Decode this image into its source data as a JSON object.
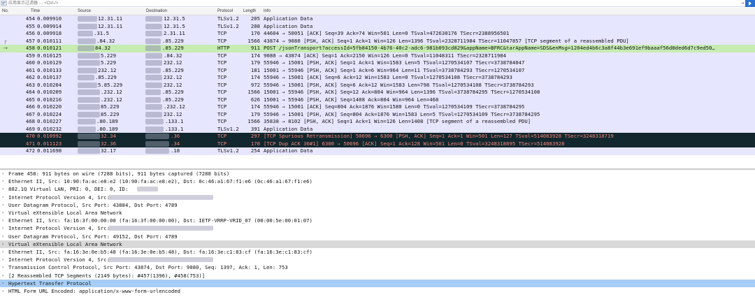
{
  "filter": {
    "placeholder": "应用显示过滤器 … <Ctrl-/>",
    "arrow": "→",
    "apply_icon": "apply-filter-icon",
    "bookmark_icon": "bookmark-filter-icon"
  },
  "columns": {
    "no": "No.",
    "time": "Time",
    "source": "Source",
    "destination": "Destination",
    "protocol": "Protocol",
    "length": "Length",
    "info": "Info"
  },
  "packets": [
    {
      "no": "454",
      "time": "0.009910",
      "src": "12.31.11",
      "dst": "12.31.5",
      "proto": "TLSv1.2",
      "len": "205",
      "info": "Application Data",
      "bg": "#e7e6ff",
      "fg": "#111111"
    },
    {
      "no": "455",
      "time": "0.009914",
      "src": "12.31.11",
      "dst": "12.31.5",
      "proto": "TLSv1.2",
      "len": "208",
      "info": "Application Data",
      "bg": "#e7e6ff",
      "fg": "#111111"
    },
    {
      "no": "456",
      "time": "0.009918",
      "src": ".31.5",
      "dst": "2.31.11",
      "proto": "TCP",
      "len": "170",
      "info": "44604 → 50051 [ACK] Seq=39 Ack=74 Win=501 Len=0 TSval=472630176 TSecr=2388956501",
      "bg": "#e7e6ff",
      "fg": "#111111"
    },
    {
      "no": "457",
      "time": "0.010111",
      "src": ".84.32",
      "dst": ".85.229",
      "proto": "TCP",
      "len": "1566",
      "info": "43874 → 9080 [PSH, ACK] Seq=1 Ack=1 Win=126 Len=1396 TSval=2328711984 TSecr=11047857 [TCP segment of a reassembled PDU]",
      "bg": "#e7e6ff",
      "fg": "#111111"
    },
    {
      "no": "458",
      "time": "0.010121",
      "src": "84.32",
      "dst": ".85.229",
      "proto": "HTTP",
      "len": "911",
      "info": "POST /jsonTransport?accessId=5fb84150-4b76-40c2-adc6-981b093cd829&appName=BFRC&tarAppName=SDS&enMsg=1204ed4b6c3a8f44b3e691ef9baaaf56d8ded6d7c9ed50…",
      "bg": "#c6ecb2",
      "fg": "#111111"
    },
    {
      "no": "459",
      "time": "0.010125",
      "src": "5.229",
      "dst": ".84.32",
      "proto": "TCP",
      "len": "174",
      "info": "9080 → 43874 [ACK] Seq=1 Ack=2150 Win=126 Len=0 TSval=11048311 TSecr=2328711984",
      "bg": "#e7e6ff",
      "fg": "#111111"
    },
    {
      "no": "460",
      "time": "0.010129",
      "src": "5.229",
      "dst": "232.12",
      "proto": "TCP",
      "len": "179",
      "info": "55946 → 15001 [PSH, ACK] Seq=1 Ack=1 Win=1583 Len=5 TSval=1270534107 TSecr=3738784047",
      "bg": "#e7e6ff",
      "fg": "#111111"
    },
    {
      "no": "461",
      "time": "0.010133",
      "src": "232.12",
      "dst": ".85.229",
      "proto": "TCP",
      "len": "181",
      "info": "15001 → 55946 [PSH, ACK] Seq=1 Ack=6 Win=964 Len=11 TSval=3738784293 TSecr=1270534107",
      "bg": "#e7e6ff",
      "fg": "#111111"
    },
    {
      "no": "462",
      "time": "0.010137",
      "src": ".85.229",
      "dst": "232.12",
      "proto": "TCP",
      "len": "174",
      "info": "55946 → 15001 [ACK] Seq=6 Ack=12 Win=1583 Len=0 TSval=1270534108 TSecr=3738784293",
      "bg": "#e7e6ff",
      "fg": "#111111"
    },
    {
      "no": "463",
      "time": "0.010204",
      "src": "5.85.229",
      "dst": "232.12",
      "proto": "TCP",
      "len": "972",
      "info": "55946 → 15001 [PSH, ACK] Seq=6 Ack=12 Win=1583 Len=798 TSval=1270534108 TSecr=3738784293",
      "bg": "#e7e6ff",
      "fg": "#111111"
    },
    {
      "no": "464",
      "time": "0.010209",
      "src": ".232.12",
      "dst": ".85.229",
      "proto": "TCP",
      "len": "1566",
      "info": "15001 → 55946 [PSH, ACK] Seq=12 Ack=804 Win=964 Len=1396 TSval=3738784295 TSecr=1270534108",
      "bg": "#e7e6ff",
      "fg": "#111111"
    },
    {
      "no": "465",
      "time": "0.010216",
      "src": ".232.12",
      "dst": ".85.229",
      "proto": "TCP",
      "len": "626",
      "info": "15001 → 55946 [PSH, ACK] Seq=1408 Ack=804 Win=964 Len=468",
      "bg": "#e7e6ff",
      "fg": "#111111"
    },
    {
      "no": "466",
      "time": "0.010220",
      "src": "85.229",
      "dst": ".232.12",
      "proto": "TCP",
      "len": "174",
      "info": "55946 → 15001 [ACK] Seq=804 Ack=1876 Win=1580 Len=0 TSval=1270534109 TSecr=3738784295",
      "bg": "#e7e6ff",
      "fg": "#111111"
    },
    {
      "no": "467",
      "time": "0.010224",
      "src": "85.229",
      "dst": "232.12",
      "proto": "TCP",
      "len": "179",
      "info": "55946 → 15001 [PSH, ACK] Seq=804 Ack=1876 Win=1583 Len=5 TSval=1270534109 TSecr=3738784295",
      "bg": "#e7e6ff",
      "fg": "#111111"
    },
    {
      "no": "468",
      "time": "0.010227",
      "src": ".80.189",
      "dst": ".133.1",
      "proto": "TCP",
      "len": "1566",
      "info": "35838 → 8102 [PSH, ACK] Seq=1 Ack=1 Win=126 Len=1408 [TCP segment of a reassembled PDU]",
      "bg": "#e7e6ff",
      "fg": "#111111"
    },
    {
      "no": "469",
      "time": "0.010232",
      "src": ".80.189",
      "dst": ".133.1",
      "proto": "TLSv1.2",
      "len": "391",
      "info": "Application Data",
      "bg": "#e7e6ff",
      "fg": "#111111"
    },
    {
      "no": "470",
      "time": "0.010992",
      "src": "32.34",
      "dst": ".36",
      "proto": "TCP",
      "len": "297",
      "info": "[TCP Spurious Retransmission] 50696 → 6300 [PSH, ACK] Seq=1 Ack=1 Win=501 Len=127 TSval=514083928 TSecr=3248318719",
      "bg": "#12272e",
      "fg": "#f7867b"
    },
    {
      "no": "471",
      "time": "0.011123",
      "src": "32.36",
      "dst": ".34",
      "proto": "TCP",
      "len": "170",
      "info": "[TCP Dup ACK 30#1] 6300 → 50696 [ACK] Seq=1 Ack=128 Win=501 Len=0 TSval=3248318895 TSecr=514083928",
      "bg": "#12272e",
      "fg": "#f7867b"
    },
    {
      "no": "472",
      "time": "0.011698",
      "src": "32.17",
      "dst": ".18",
      "proto": "TLSv1.2",
      "len": "254",
      "info": "Application Data",
      "bg": "#e7e6ff",
      "fg": "#111111"
    }
  ],
  "details": [
    {
      "text": "Frame 458: 911 bytes on wire (7288 bits), 911 bytes captured (7288 bits)",
      "bg": "#ffffff"
    },
    {
      "text": "Ethernet II, Src: 10:90:fa:ac:e8:e2 (10:90:fa:ac:e8:e2), Dst: 0c:46:a1:67:f1:e6 (0c:46:a1:67:f1:e6)",
      "bg": "#ffffff"
    },
    {
      "text": "802.1Q Virtual LAN, PRI: 0, DEI: 0, ID:",
      "bg": "#ffffff"
    },
    {
      "text": "Internet Protocol Version 4, Src:",
      "bg": "#ffffff"
    },
    {
      "text": "User Datagram Protocol, Src Port: 43884, Dst Port: 4789",
      "bg": "#ffffff"
    },
    {
      "text": "Virtual eXtensible Local Area Network",
      "bg": "#ffffff"
    },
    {
      "text": "Ethernet II, Src: fa:16:3f:00:00:00 (fa:16:3f:00:00:00), Dst: IETF-VRRP-VRID_07 (00:00:5e:00:01:07)",
      "bg": "#ffffff"
    },
    {
      "text": "Internet Protocol Version 4, Src:",
      "bg": "#ffffff"
    },
    {
      "text": "User Datagram Protocol, Src Port: 49152, Dst Port: 4789",
      "bg": "#ffffff"
    },
    {
      "text": "Virtual eXtensible Local Area Network",
      "bg": "#d9d9d9"
    },
    {
      "text": "Ethernet II, Src: fa:16:3e:0e:b5:48 (fa:16:3e:0e:b5:48), Dst: fa:16:3e:c1:83:cf (fa:16:3e:c1:83:cf)",
      "bg": "#ffffff"
    },
    {
      "text": "Internet Protocol Version 4, Src:",
      "bg": "#ffffff"
    },
    {
      "text": "Transmission Control Protocol, Src Port: 43874, Dst Port: 9080, Seq: 1397, Ack: 1, Len: 753",
      "bg": "#ffffff"
    },
    {
      "text": "[2 Reassembled TCP Segments (2149 bytes): #457(1396), #458(753)]",
      "bg": "#ffffff"
    },
    {
      "text": "Hypertext Transfer Protocol",
      "bg": "#a6cdf5"
    },
    {
      "text": "HTML Form URL Encoded: application/x-www-form-urlencoded",
      "bg": "#ffffff"
    }
  ],
  "colors": {
    "tcp_row": "#e7e6ff",
    "http_row": "#c6ecb2",
    "error_row": "#12272e",
    "error_text": "#f7867b",
    "selected_detail": "#a6cdf5"
  }
}
